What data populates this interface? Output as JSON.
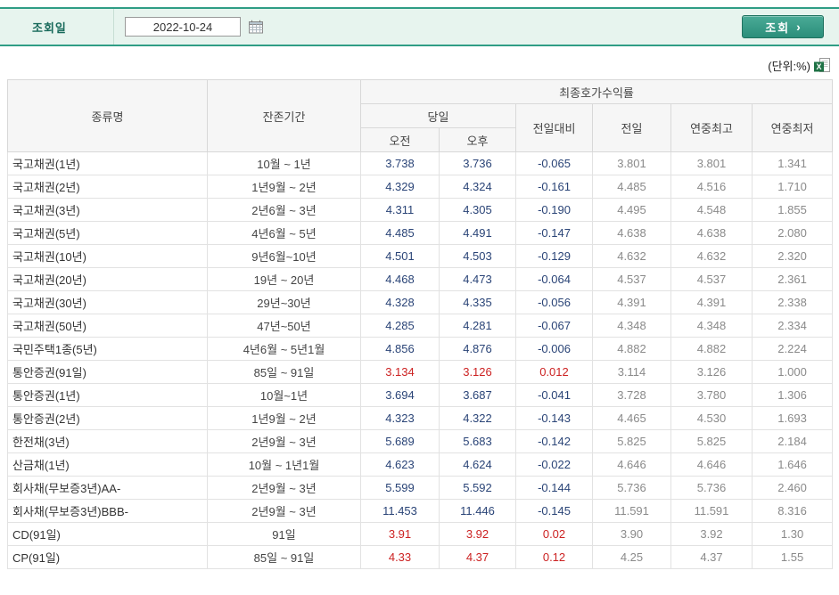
{
  "query_bar": {
    "date_label": "조회일",
    "date_value": "2022-10-24",
    "search_label": "조회",
    "search_arrow": "›"
  },
  "meta": {
    "unit_label": "(단위:%)"
  },
  "table": {
    "headers": {
      "type": "종류명",
      "period": "잔존기간",
      "yield_group": "최종호가수익률",
      "today": "당일",
      "morning": "오전",
      "afternoon": "오후",
      "vs_prev": "전일대비",
      "prev_day": "전일",
      "year_high": "연중최고",
      "year_low": "연중최저"
    },
    "colors": {
      "up": "#cc2222",
      "down": "#2a4477",
      "muted": "#8a8a8a",
      "accent": "#2f9d85"
    },
    "rows": [
      {
        "type": "국고채권(1년)",
        "period": "10월 ~ 1년",
        "am": "3.738",
        "pm": "3.736",
        "diff": "-0.065",
        "prev": "3.801",
        "high": "3.801",
        "low": "1.341",
        "direction": "down"
      },
      {
        "type": "국고채권(2년)",
        "period": "1년9월 ~ 2년",
        "am": "4.329",
        "pm": "4.324",
        "diff": "-0.161",
        "prev": "4.485",
        "high": "4.516",
        "low": "1.710",
        "direction": "down"
      },
      {
        "type": "국고채권(3년)",
        "period": "2년6월 ~ 3년",
        "am": "4.311",
        "pm": "4.305",
        "diff": "-0.190",
        "prev": "4.495",
        "high": "4.548",
        "low": "1.855",
        "direction": "down"
      },
      {
        "type": "국고채권(5년)",
        "period": "4년6월 ~ 5년",
        "am": "4.485",
        "pm": "4.491",
        "diff": "-0.147",
        "prev": "4.638",
        "high": "4.638",
        "low": "2.080",
        "direction": "down"
      },
      {
        "type": "국고채권(10년)",
        "period": "9년6월~10년",
        "am": "4.501",
        "pm": "4.503",
        "diff": "-0.129",
        "prev": "4.632",
        "high": "4.632",
        "low": "2.320",
        "direction": "down"
      },
      {
        "type": "국고채권(20년)",
        "period": "19년 ~ 20년",
        "am": "4.468",
        "pm": "4.473",
        "diff": "-0.064",
        "prev": "4.537",
        "high": "4.537",
        "low": "2.361",
        "direction": "down"
      },
      {
        "type": "국고채권(30년)",
        "period": "29년~30년",
        "am": "4.328",
        "pm": "4.335",
        "diff": "-0.056",
        "prev": "4.391",
        "high": "4.391",
        "low": "2.338",
        "direction": "down"
      },
      {
        "type": "국고채권(50년)",
        "period": "47년~50년",
        "am": "4.285",
        "pm": "4.281",
        "diff": "-0.067",
        "prev": "4.348",
        "high": "4.348",
        "low": "2.334",
        "direction": "down"
      },
      {
        "type": "국민주택1종(5년)",
        "period": "4년6월 ~ 5년1월",
        "am": "4.856",
        "pm": "4.876",
        "diff": "-0.006",
        "prev": "4.882",
        "high": "4.882",
        "low": "2.224",
        "direction": "down"
      },
      {
        "type": "통안증권(91일)",
        "period": "85일 ~ 91일",
        "am": "3.134",
        "pm": "3.126",
        "diff": "0.012",
        "prev": "3.114",
        "high": "3.126",
        "low": "1.000",
        "direction": "up"
      },
      {
        "type": "통안증권(1년)",
        "period": "10월~1년",
        "am": "3.694",
        "pm": "3.687",
        "diff": "-0.041",
        "prev": "3.728",
        "high": "3.780",
        "low": "1.306",
        "direction": "down"
      },
      {
        "type": "통안증권(2년)",
        "period": "1년9월 ~ 2년",
        "am": "4.323",
        "pm": "4.322",
        "diff": "-0.143",
        "prev": "4.465",
        "high": "4.530",
        "low": "1.693",
        "direction": "down"
      },
      {
        "type": "한전채(3년)",
        "period": "2년9월 ~ 3년",
        "am": "5.689",
        "pm": "5.683",
        "diff": "-0.142",
        "prev": "5.825",
        "high": "5.825",
        "low": "2.184",
        "direction": "down"
      },
      {
        "type": "산금채(1년)",
        "period": "10월 ~ 1년1월",
        "am": "4.623",
        "pm": "4.624",
        "diff": "-0.022",
        "prev": "4.646",
        "high": "4.646",
        "low": "1.646",
        "direction": "down"
      },
      {
        "type": "회사채(무보증3년)AA-",
        "period": "2년9월 ~ 3년",
        "am": "5.599",
        "pm": "5.592",
        "diff": "-0.144",
        "prev": "5.736",
        "high": "5.736",
        "low": "2.460",
        "direction": "down"
      },
      {
        "type": "회사채(무보증3년)BBB-",
        "period": "2년9월 ~ 3년",
        "am": "11.453",
        "pm": "11.446",
        "diff": "-0.145",
        "prev": "11.591",
        "high": "11.591",
        "low": "8.316",
        "direction": "down"
      },
      {
        "type": "CD(91일)",
        "period": "91일",
        "am": "3.91",
        "pm": "3.92",
        "diff": "0.02",
        "prev": "3.90",
        "high": "3.92",
        "low": "1.30",
        "direction": "up"
      },
      {
        "type": "CP(91일)",
        "period": "85일 ~ 91일",
        "am": "4.33",
        "pm": "4.37",
        "diff": "0.12",
        "prev": "4.25",
        "high": "4.37",
        "low": "1.55",
        "direction": "up"
      }
    ]
  }
}
